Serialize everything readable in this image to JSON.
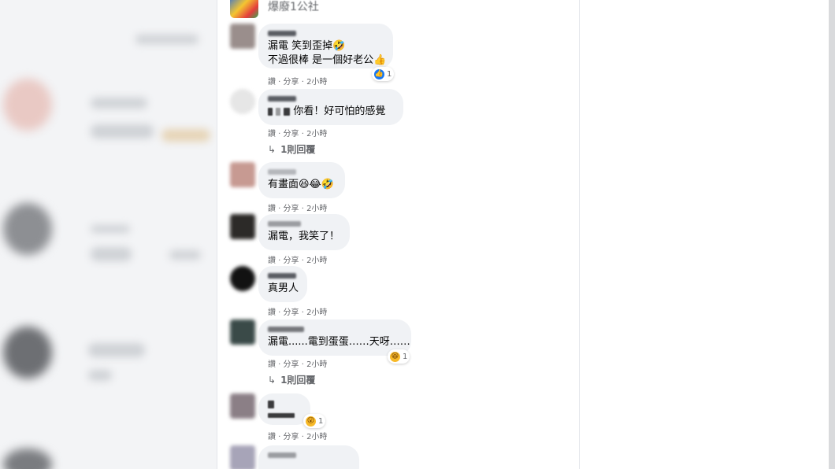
{
  "page": {
    "name": "爆廢1公社"
  },
  "colors": {
    "bubble": "#f0f2f5",
    "like": "#1877f2",
    "haha": "#f7b928",
    "meta": "#65676b"
  },
  "comments": [
    {
      "lines": [
        "漏電 笑到歪掉🤣",
        "不過很棒 是一個好老公👍"
      ],
      "actions": "讚 · 分享 · 2小時",
      "reaction_icon": "like-icon",
      "reaction_count": "1"
    },
    {
      "lines": [
        "你看！好可怕的感覺"
      ],
      "actions": "讚 · 分享 · 2小時",
      "reply": "1則回覆"
    },
    {
      "lines": [
        "有畫面😆😂🤣"
      ],
      "actions": "讚 · 分享 · 2小時"
    },
    {
      "lines": [
        "漏電，我笑了！"
      ],
      "actions": "讚 · 分享 · 2小時"
    },
    {
      "lines": [
        "真男人"
      ],
      "actions": "讚 · 分享 · 2小時"
    },
    {
      "lines": [
        "漏電......電到蛋蛋……天呀……"
      ],
      "actions": "讚 · 分享 · 2小時",
      "reaction_icon": "haha-icon",
      "reaction_count": "1",
      "reply": "1則回覆"
    },
    {
      "lines": [],
      "actions": "讚 · 分享 · 2小時",
      "reaction_icon": "wow-icon",
      "reaction_count": "1"
    },
    {
      "lines": []
    }
  ]
}
